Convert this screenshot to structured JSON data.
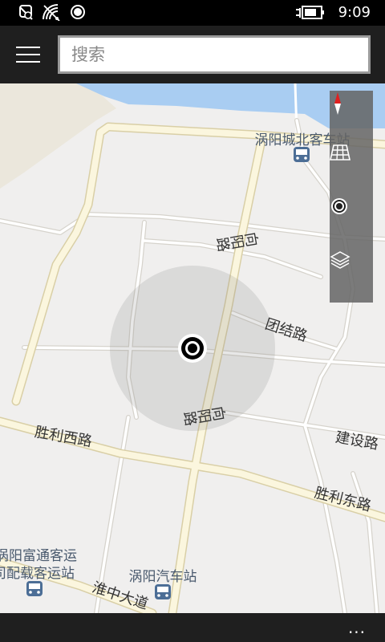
{
  "status_bar": {
    "time": "9:09",
    "icons": [
      "nfc-icon",
      "wifi-icon",
      "location-icon",
      "battery-charging-icon"
    ]
  },
  "header": {
    "menu_icon": "hamburger-menu-icon",
    "search": {
      "placeholder": "搜索",
      "value": ""
    }
  },
  "map": {
    "roads": {
      "xiangyang_north": "向阳路",
      "xiangyang_south": "向阳路",
      "tuanjie": "团结路",
      "shengli_west": "胜利西路",
      "shengli_east": "胜利东路",
      "jianshe": "建设路",
      "huaizhong": "淮中大道"
    },
    "pois": {
      "north_bus_station": "涡阳城北客车站",
      "bus_station": "涡阳汽车站",
      "futong_line1": "涡阳富通客运",
      "futong_line2": "公司配载客运站"
    },
    "toolbar": [
      "compass-icon",
      "aerial-view-icon",
      "my-location-icon",
      "layers-icon"
    ],
    "colors": {
      "land": "#f0efee",
      "water": "#a9cdf2",
      "major_road": "#fbf6de",
      "location": "#000000"
    }
  },
  "app_bar": {
    "more_label": "..."
  }
}
